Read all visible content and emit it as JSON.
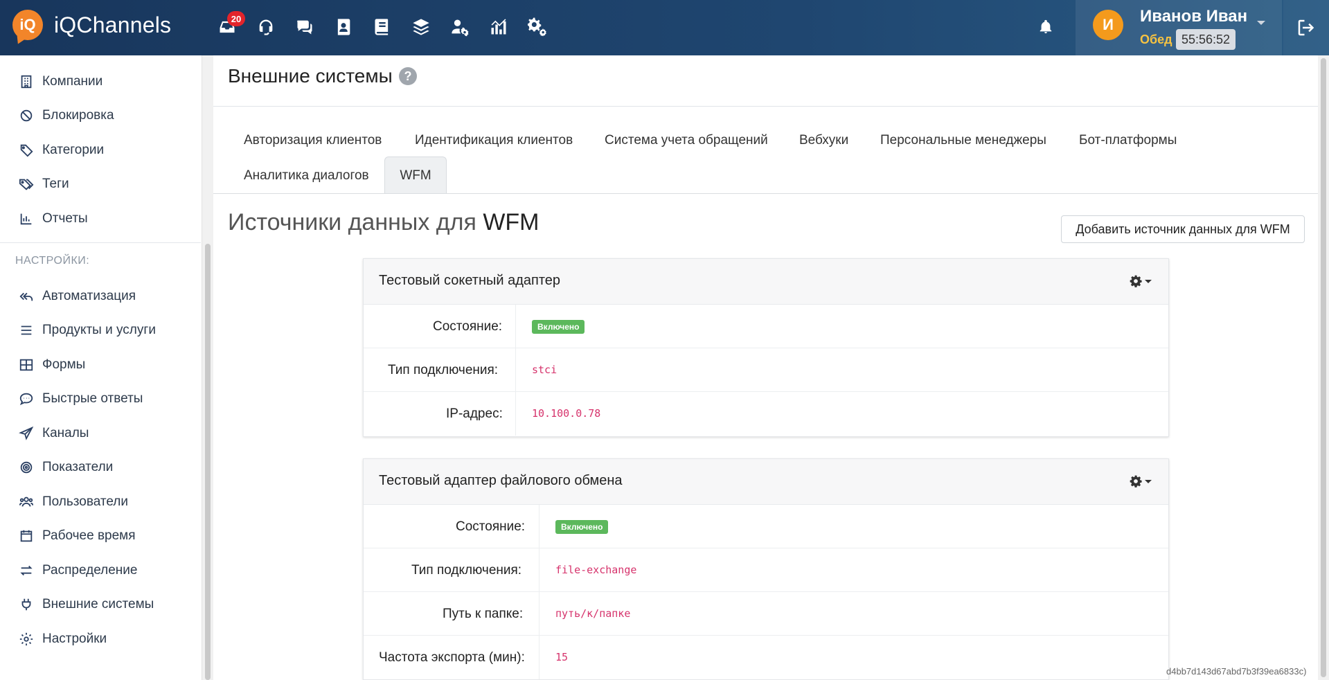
{
  "header": {
    "logo_badge": "iQ",
    "app_name": "iQChannels",
    "inbox_count": "20",
    "nav_icons": [
      "inbox-icon",
      "headset-icon",
      "chats-icon",
      "contacts-icon",
      "book-icon",
      "layers-icon",
      "user-settings-icon",
      "analytics-icon",
      "cogs-icon"
    ],
    "user": {
      "initial": "И",
      "name": "Иванов Иван",
      "status": "Обед",
      "timer": "55:56:52"
    }
  },
  "sidebar": {
    "items_top": [
      {
        "label": "Компании",
        "icon": "building-icon"
      },
      {
        "label": "Блокировка",
        "icon": "ban-icon"
      },
      {
        "label": "Категории",
        "icon": "tag-icon"
      },
      {
        "label": "Теги",
        "icon": "tags-icon"
      },
      {
        "label": "Отчеты",
        "icon": "bar-chart-icon"
      }
    ],
    "settings_heading": "НАСТРОЙКИ:",
    "items_settings": [
      {
        "label": "Автоматизация",
        "icon": "reply-all-icon"
      },
      {
        "label": "Продукты и услуги",
        "icon": "list-icon"
      },
      {
        "label": "Формы",
        "icon": "table-icon"
      },
      {
        "label": "Быстрые ответы",
        "icon": "comment-dots-icon"
      },
      {
        "label": "Каналы",
        "icon": "paper-plane-icon"
      },
      {
        "label": "Показатели",
        "icon": "bullseye-icon"
      },
      {
        "label": "Пользователи",
        "icon": "users-icon"
      },
      {
        "label": "Рабочее время",
        "icon": "calendar-icon"
      },
      {
        "label": "Распределение",
        "icon": "exchange-icon"
      },
      {
        "label": "Внешние системы",
        "icon": "plug-icon"
      },
      {
        "label": "Настройки",
        "icon": "gear-icon"
      }
    ]
  },
  "page": {
    "title": "Внешние системы",
    "tabs": [
      "Авторизация клиентов",
      "Идентификация клиентов",
      "Система учета обращений",
      "Вебхуки",
      "Персональные менеджеры",
      "Бот-платформы",
      "Аналитика диалогов",
      "WFM"
    ],
    "active_tab": "WFM",
    "section_title_prefix": "Источники данных для",
    "section_title_suffix": "WFM",
    "add_button": "Добавить источник данных для WFM",
    "footer_hash": "d4bb7d143d67abd7b3f39ea6833c)"
  },
  "cards": [
    {
      "title": "Тестовый сокетный адаптер",
      "rows": [
        {
          "label": "Состояние:",
          "value": "Включено",
          "kind": "badge"
        },
        {
          "label": "Тип подключения:",
          "value": "stci",
          "kind": "code"
        },
        {
          "label": "IP-адрес:",
          "value": "10.100.0.78",
          "kind": "code"
        }
      ]
    },
    {
      "title": "Тестовый адаптер файлового обмена",
      "rows": [
        {
          "label": "Состояние:",
          "value": "Включено",
          "kind": "badge"
        },
        {
          "label": "Тип подключения:",
          "value": "file-exchange",
          "kind": "code"
        },
        {
          "label": "Путь к папке:",
          "value": "путь/к/папке",
          "kind": "code"
        },
        {
          "label": "Частота экспорта (мин):",
          "value": "15",
          "kind": "code"
        }
      ]
    }
  ],
  "colors": {
    "header_bg": "#1f4670",
    "brand_orange": "#f2852a",
    "badge_red": "#e3242b",
    "status_yellow": "#f6c342",
    "enabled_green": "#5cb85c",
    "code_pink": "#d6336c"
  }
}
